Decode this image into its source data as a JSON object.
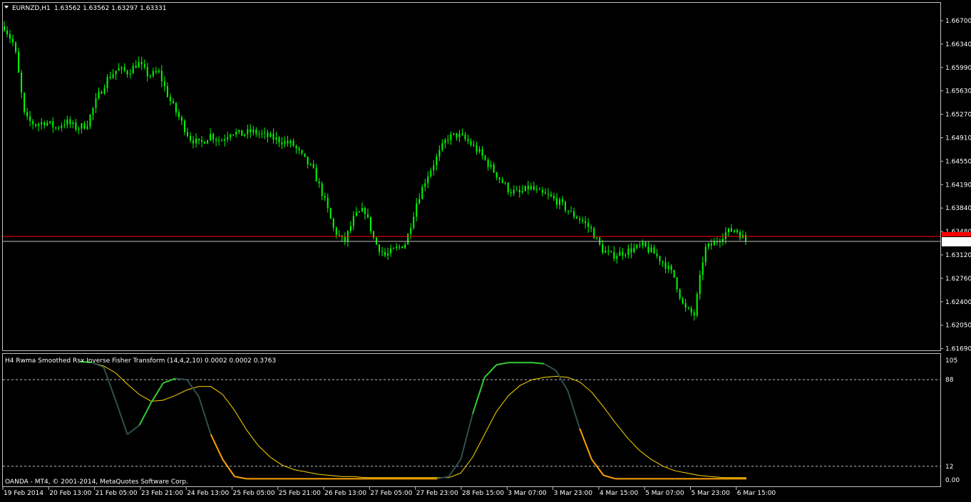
{
  "chart_header": {
    "menu_icon": "triangle-down-icon",
    "symbol": "EURNZD,H1",
    "ohlc": "1.63562 1.63562 1.63297 1.63331"
  },
  "indicator_header": {
    "title": "H4 Rwma Smoothed Rsx Inverse Fisher Transform (14,4,2,10) 0.0002 0.0002 0.3763"
  },
  "broker_label": "OANDA - MT4, © 2001-2014, MetaQuotes Software Corp.",
  "colors": {
    "background": "#000000",
    "candle": "#00ff00",
    "bid_line": "#ff0000",
    "ask_line": "#c0c0c0",
    "fisher_up": "#32cd32",
    "fisher_neutral": "#2f4f4f",
    "fisher_down": "#ffa500",
    "signal": "#ffd700",
    "frame": "#c0c0c0"
  },
  "price_scale": {
    "labels": [
      "1.66700",
      "1.66340",
      "1.65990",
      "1.65630",
      "1.65270",
      "1.64910",
      "1.64550",
      "1.64190",
      "1.63840",
      "1.63480",
      "1.63120",
      "1.62760",
      "1.62400",
      "1.62050",
      "1.61690"
    ],
    "current_price": "1.63331",
    "max": 1.667,
    "min": 1.6169
  },
  "indicator_scale": {
    "labels": [
      "105",
      "88",
      "12",
      "0.00"
    ],
    "levels": [
      88,
      12
    ],
    "min": 0,
    "max": 105
  },
  "time_axis": {
    "labels": [
      "19 Feb 2014",
      "20 Feb 13:00",
      "21 Feb 05:00",
      "23 Feb 21:00",
      "24 Feb 13:00",
      "25 Feb 05:00",
      "25 Feb 21:00",
      "26 Feb 13:00",
      "27 Feb 05:00",
      "27 Feb 23:00",
      "28 Feb 15:00",
      "3 Mar 07:00",
      "3 Mar 23:00",
      "4 Mar 15:00",
      "5 Mar 07:00",
      "5 Mar 23:00",
      "6 Mar 15:00"
    ]
  },
  "chart_data": {
    "type": "candlestick",
    "timeframe": "H1",
    "price_path": [
      1.666,
      1.663,
      1.652,
      1.651,
      1.6515,
      1.6505,
      1.6515,
      1.6505,
      1.651,
      1.655,
      1.658,
      1.6595,
      1.659,
      1.6605,
      1.6585,
      1.659,
      1.655,
      1.652,
      1.649,
      1.648,
      1.6495,
      1.6485,
      1.65,
      1.6495,
      1.65,
      1.6495,
      1.649,
      1.6485,
      1.648,
      1.646,
      1.644,
      1.64,
      1.635,
      1.633,
      1.637,
      1.638,
      1.633,
      1.631,
      1.632,
      1.633,
      1.639,
      1.643,
      1.646,
      1.649,
      1.6495,
      1.6485,
      1.647,
      1.645,
      1.643,
      1.641,
      1.6405,
      1.6415,
      1.6405,
      1.64,
      1.639,
      1.6375,
      1.6365,
      1.635,
      1.632,
      1.631,
      1.6315,
      1.632,
      1.6325,
      1.6315,
      1.63,
      1.628,
      1.623,
      1.622,
      1.632,
      1.633,
      1.6345,
      1.6351,
      1.6333
    ],
    "indicator": {
      "name": "H4 Rwma Smoothed Rsx Inverse Fisher Transform",
      "params": "(14,4,2,10)",
      "values": [
        0.0002,
        0.0002,
        0.3763
      ],
      "main_line": [
        104,
        103,
        99,
        70,
        40,
        48,
        68,
        85,
        89,
        88,
        73,
        40,
        18,
        3,
        1,
        1,
        1,
        1,
        1,
        1,
        1,
        1,
        1,
        1,
        1,
        1,
        1,
        1,
        1,
        1,
        1,
        3,
        18,
        58,
        90,
        101,
        103,
        103,
        103,
        102,
        96,
        78,
        45,
        18,
        4,
        1,
        1,
        1,
        1,
        1,
        1,
        1,
        1,
        1,
        1,
        1,
        1
      ],
      "signal_line": [
        104,
        103,
        100,
        94,
        84,
        75,
        69,
        70,
        74,
        79,
        82,
        82,
        75,
        61,
        44,
        30,
        20,
        13,
        9,
        7,
        5,
        4,
        3,
        3,
        2,
        2,
        2,
        2,
        2,
        2,
        2,
        2,
        6,
        20,
        40,
        60,
        74,
        83,
        88,
        90,
        91,
        90,
        86,
        77,
        64,
        50,
        37,
        26,
        18,
        12,
        8,
        6,
        4,
        3,
        2,
        2,
        2
      ]
    }
  }
}
